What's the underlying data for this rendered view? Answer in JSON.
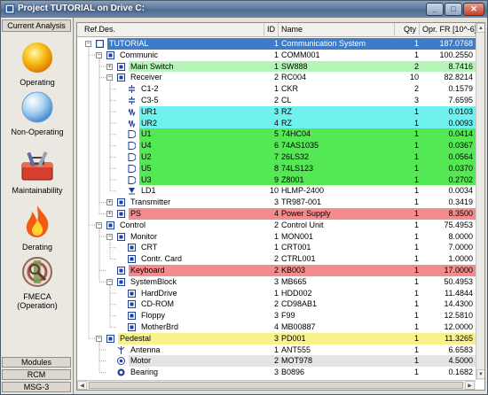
{
  "window": {
    "title": "Project TUTORIAL  on Drive C:",
    "controls": {
      "minimize": "_",
      "maximize": "□",
      "close": "✕"
    }
  },
  "left_panel": {
    "header": "Current Analysis",
    "items": [
      {
        "label": "Operating",
        "icon": "sun-icon"
      },
      {
        "label": "Non-Operating",
        "icon": "moon-icon"
      },
      {
        "label": "Maintainability",
        "icon": "toolbox-icon"
      },
      {
        "label": "Derating",
        "icon": "flame-icon"
      },
      {
        "label": "FMECA\n(Operation)",
        "icon": "fmeca-icon"
      }
    ],
    "bottom_tabs": [
      "Modules",
      "RCM",
      "MSG-3"
    ]
  },
  "grid": {
    "columns": [
      "Ref.Des.",
      "ID",
      "Name",
      "Qty",
      "Opr. FR [10^-6]"
    ],
    "colors": {
      "selected": "#3f7bc6",
      "green": "#b6f5b8",
      "bright_green": "#55e855",
      "cyan": "#6ff2ef",
      "red": "#f38d8d",
      "yellow": "#f9f28a",
      "grey": "#e4e4e4"
    },
    "rows": [
      {
        "ref": "TUTORIAL",
        "id": "1",
        "name": "Communication System",
        "qty": "1",
        "fr": "187.0768",
        "level": 0,
        "icon": "system-icon",
        "exp": "-",
        "hl": "selected"
      },
      {
        "ref": "Communic",
        "id": "1",
        "name": "COMM001",
        "qty": "1",
        "fr": "100.2550",
        "level": 1,
        "icon": "assembly-icon",
        "exp": "-",
        "hl": ""
      },
      {
        "ref": "Main Switch",
        "id": "1",
        "name": "SW888",
        "qty": "2",
        "fr": "8.7416",
        "level": 2,
        "icon": "assembly-icon",
        "exp": "+",
        "hl": "green"
      },
      {
        "ref": "Receiver",
        "id": "2",
        "name": "RC004",
        "qty": "10",
        "fr": "82.8214",
        "level": 2,
        "icon": "assembly-icon",
        "exp": "-",
        "hl": ""
      },
      {
        "ref": "C1-2",
        "id": "1",
        "name": "CKR",
        "qty": "2",
        "fr": "0.1579",
        "level": 3,
        "icon": "capacitor-icon",
        "exp": "",
        "hl": ""
      },
      {
        "ref": "C3-5",
        "id": "2",
        "name": "CL",
        "qty": "3",
        "fr": "7.6595",
        "level": 3,
        "icon": "capacitor-icon",
        "exp": "",
        "hl": ""
      },
      {
        "ref": "UR1",
        "id": "3",
        "name": "RZ",
        "qty": "1",
        "fr": "0.0103",
        "level": 3,
        "icon": "resistor-icon",
        "exp": "",
        "hl": "cyan"
      },
      {
        "ref": "UR2",
        "id": "4",
        "name": "RZ",
        "qty": "1",
        "fr": "0.0093",
        "level": 3,
        "icon": "resistor-icon",
        "exp": "",
        "hl": "cyan"
      },
      {
        "ref": "U1",
        "id": "5",
        "name": "74HC04",
        "qty": "1",
        "fr": "0.0414",
        "level": 3,
        "icon": "ic-icon",
        "exp": "",
        "hl": "bright_green"
      },
      {
        "ref": "U4",
        "id": "6",
        "name": "74AS1035",
        "qty": "1",
        "fr": "0.0367",
        "level": 3,
        "icon": "ic-icon",
        "exp": "",
        "hl": "bright_green"
      },
      {
        "ref": "U2",
        "id": "7",
        "name": "26LS32",
        "qty": "1",
        "fr": "0.0564",
        "level": 3,
        "icon": "ic-icon",
        "exp": "",
        "hl": "bright_green"
      },
      {
        "ref": "U5",
        "id": "8",
        "name": "74LS123",
        "qty": "1",
        "fr": "0.0370",
        "level": 3,
        "icon": "ic-icon",
        "exp": "",
        "hl": "bright_green"
      },
      {
        "ref": "U3",
        "id": "9",
        "name": "Z8001",
        "qty": "1",
        "fr": "0.2702",
        "level": 3,
        "icon": "ic-icon",
        "exp": "",
        "hl": "bright_green"
      },
      {
        "ref": "LD1",
        "id": "10",
        "name": "HLMP-2400",
        "qty": "1",
        "fr": "0.0034",
        "level": 3,
        "icon": "led-icon",
        "exp": "",
        "hl": ""
      },
      {
        "ref": "Transmitter",
        "id": "3",
        "name": "TR987-001",
        "qty": "1",
        "fr": "0.3419",
        "level": 2,
        "icon": "assembly-icon",
        "exp": "+",
        "hl": ""
      },
      {
        "ref": "PS",
        "id": "4",
        "name": "Power Supply",
        "qty": "1",
        "fr": "8.3500",
        "level": 2,
        "icon": "assembly-icon",
        "exp": "+",
        "hl": "red"
      },
      {
        "ref": "Control",
        "id": "2",
        "name": "Control Unit",
        "qty": "1",
        "fr": "75.4953",
        "level": 1,
        "icon": "assembly-icon",
        "exp": "-",
        "hl": ""
      },
      {
        "ref": "Monitor",
        "id": "1",
        "name": "MON001",
        "qty": "1",
        "fr": "8.0000",
        "level": 2,
        "icon": "assembly-icon",
        "exp": "-",
        "hl": ""
      },
      {
        "ref": "CRT",
        "id": "1",
        "name": "CRT001",
        "qty": "1",
        "fr": "7.0000",
        "level": 3,
        "icon": "assembly-icon",
        "exp": "",
        "hl": ""
      },
      {
        "ref": "Contr. Card",
        "id": "2",
        "name": "CTRL001",
        "qty": "1",
        "fr": "1.0000",
        "level": 3,
        "icon": "assembly-icon",
        "exp": "",
        "hl": ""
      },
      {
        "ref": "Keyboard",
        "id": "2",
        "name": "KB003",
        "qty": "1",
        "fr": "17.0000",
        "level": 2,
        "icon": "assembly-icon",
        "exp": "",
        "hl": "red"
      },
      {
        "ref": "SystemBlock",
        "id": "3",
        "name": "MB665",
        "qty": "1",
        "fr": "50.4953",
        "level": 2,
        "icon": "assembly-icon",
        "exp": "-",
        "hl": ""
      },
      {
        "ref": "HardDrive",
        "id": "1",
        "name": "HDD002",
        "qty": "1",
        "fr": "11.4844",
        "level": 3,
        "icon": "assembly-icon",
        "exp": "",
        "hl": ""
      },
      {
        "ref": "CD-ROM",
        "id": "2",
        "name": "CD98AB1",
        "qty": "1",
        "fr": "14.4300",
        "level": 3,
        "icon": "assembly-icon",
        "exp": "",
        "hl": ""
      },
      {
        "ref": "Floppy",
        "id": "3",
        "name": "F99",
        "qty": "1",
        "fr": "12.5810",
        "level": 3,
        "icon": "assembly-icon",
        "exp": "",
        "hl": ""
      },
      {
        "ref": "MotherBrd",
        "id": "4",
        "name": "MB00887",
        "qty": "1",
        "fr": "12.0000",
        "level": 3,
        "icon": "assembly-icon",
        "exp": "",
        "hl": ""
      },
      {
        "ref": "Pedestal",
        "id": "3",
        "name": "PD001",
        "qty": "1",
        "fr": "11.3265",
        "level": 1,
        "icon": "assembly-icon",
        "exp": "-",
        "hl": "yellow"
      },
      {
        "ref": "Antenna",
        "id": "1",
        "name": "ANT555",
        "qty": "1",
        "fr": "6.6583",
        "level": 2,
        "icon": "antenna-icon",
        "exp": "",
        "hl": ""
      },
      {
        "ref": "Motor",
        "id": "2",
        "name": "MOT978",
        "qty": "1",
        "fr": "4.5000",
        "level": 2,
        "icon": "motor-icon",
        "exp": "",
        "hl": "grey"
      },
      {
        "ref": "Bearing",
        "id": "3",
        "name": "B0896",
        "qty": "1",
        "fr": "0.1682",
        "level": 2,
        "icon": "bearing-icon",
        "exp": "",
        "hl": ""
      }
    ]
  }
}
